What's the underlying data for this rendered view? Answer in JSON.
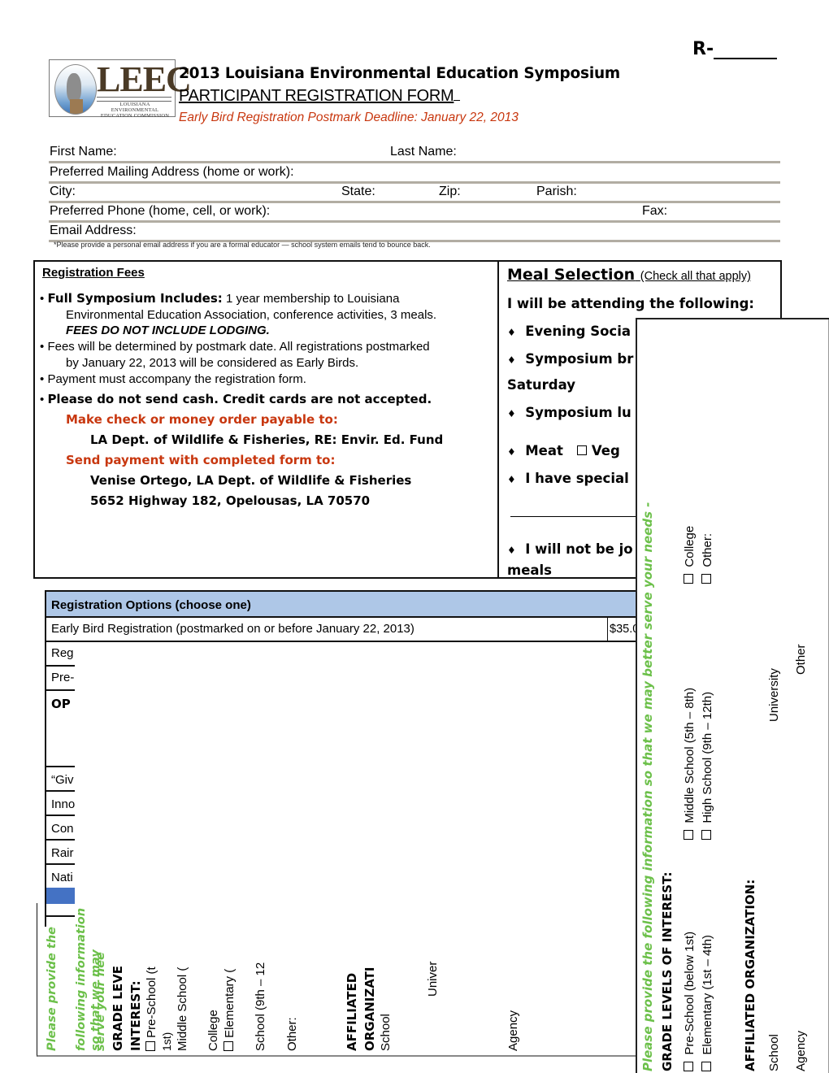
{
  "header": {
    "form_number_prefix": "R-",
    "logo": {
      "wordmark": "LEEC",
      "subtitle_line1": "LOUISIANA ENVIRONMENTAL",
      "subtitle_line2": "EDUCATION COMMISSION"
    },
    "title": "2013 Louisiana Environmental Education Symposium",
    "subtitle": "PARTICIPANT REGISTRATION FORM",
    "deadline": "Early Bird Registration Postmark Deadline: January 22, 2013"
  },
  "participant_fields": {
    "first_name": "First Name:",
    "last_name": "Last Name:",
    "mailing_address": "Preferred Mailing Address (home or work):",
    "city": "City:",
    "state": "State:",
    "zip": "Zip:",
    "parish": "Parish:",
    "phone": "Preferred Phone (home, cell, or work):",
    "fax": "Fax:",
    "email": "Email Address:",
    "email_note": "*Please provide a personal email address if you are a formal educator — school system emails tend to bounce back."
  },
  "registration_fees": {
    "heading": "Registration Fees",
    "bullet1_bold": "Full Symposium Includes:",
    "bullet1_text": " 1 year membership to Louisiana",
    "bullet1_line2": "Environmental Education Association, conference activities, 3 meals.",
    "bullet1_line3": "FEES DO NOT INCLUDE LODGING.",
    "bullet2_line1": "Fees will be determined by postmark date. All registrations postmarked",
    "bullet2_line2": "by January 22, 2013 will be considered as Early Birds.",
    "bullet3": "Payment must accompany the registration form.",
    "bullet4": "Please do not send cash. Credit cards are not accepted.",
    "payable_label": "Make check or money order payable to:",
    "payable_to": "LA Dept. of Wildlife & Fisheries, RE: Envir. Ed. Fund",
    "send_label": "Send payment with completed form  to:",
    "send_name": "Venise Ortego, LA Dept. of Wildlife & Fisheries",
    "send_address": "5652 Highway 182, Opelousas, LA  70570",
    "bullet_glyph": "•"
  },
  "meal_selection": {
    "heading": "Meal Selection",
    "heading_note": "(Check all that apply)",
    "attending": "I will be attending the following:",
    "diamond": "♦",
    "item1": "Evening Socia",
    "item2": "Symposium br",
    "saturday": "Saturday",
    "item3": "Symposium lu",
    "meat": "Meat",
    "veg": "Veg",
    "special": "I have special",
    "not_joining": "I will not be jo",
    "meals": "meals"
  },
  "registration_options": {
    "header": "Registration Options (choose one)",
    "rows": [
      {
        "label": "Early Bird Registration (postmarked on or before January 22, 2013)",
        "price": "$35.0"
      },
      {
        "label": "Reg"
      },
      {
        "label": "Pre-"
      },
      {
        "label": "OP"
      },
      {
        "label": "“Giv"
      },
      {
        "label": "Inno"
      },
      {
        "label": "Con"
      },
      {
        "label": "Rair"
      },
      {
        "label": "Nati"
      }
    ]
  },
  "interest_panel_left": {
    "prompt_line1": "Please provide the",
    "prompt_line2": "following information",
    "prompt_line3": "so that we may",
    "prompt_line4": "serve your nee",
    "grade_heading1": "GRADE LEVE",
    "grade_heading2": "INTEREST:",
    "preschool": "Pre-School (t",
    "first": "1st)",
    "middle": "Middle School (",
    "college": "College",
    "elementary": "Elementary (",
    "high": "School (9th – 12",
    "other": "Other:",
    "org_heading1": "AFFILIATED",
    "org_heading2": "ORGANIZATI",
    "school": "School",
    "university": "Univer",
    "agency": "Agency"
  },
  "interest_panel_right": {
    "prompt": "Please provide the following information so that we may better serve your needs -",
    "grade_heading": "GRADE LEVELS OF INTEREST:",
    "preschool": "Pre-School (below 1st)",
    "elementary": "Elementary (1st – 4th)",
    "middle": "Middle School (5th – 8th)",
    "high": "High School (9th – 12th)",
    "college": "College",
    "other": "Other:",
    "org_heading": "AFFILIATED ORGANIZATION:",
    "school": "School",
    "agency": "Agency",
    "university": "University",
    "org_other": "Other"
  },
  "colors": {
    "accent_red": "#c8370f",
    "green": "#6cc04a",
    "header_blue": "#aec7e7",
    "bar_blue": "#4472c4"
  }
}
